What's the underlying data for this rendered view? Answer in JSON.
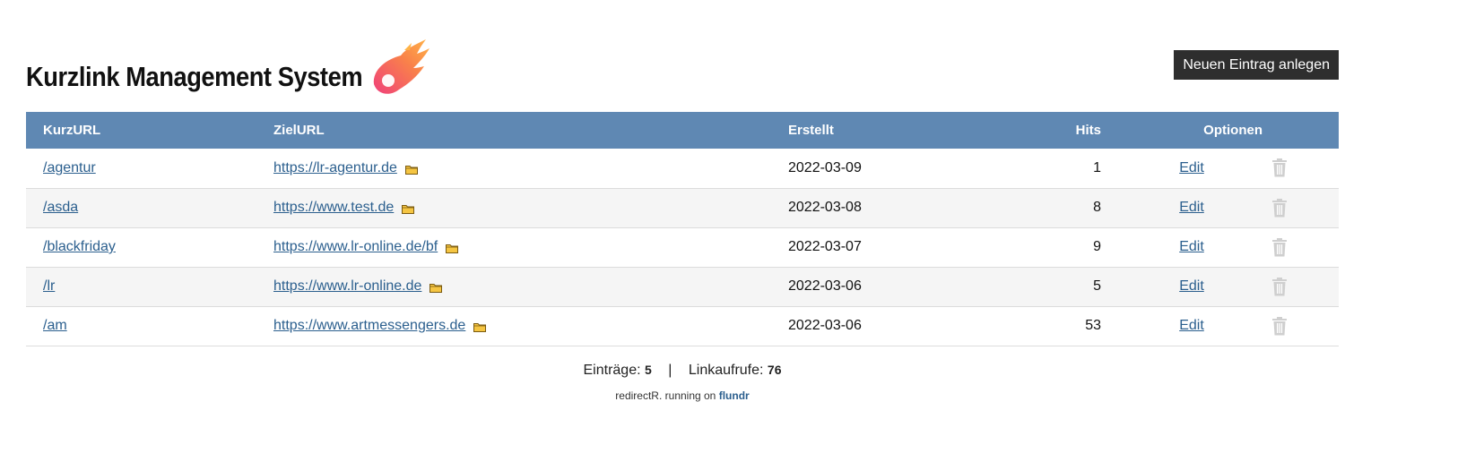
{
  "header": {
    "title": "Kurzlink Management System",
    "new_button": "Neuen Eintrag anlegen"
  },
  "table": {
    "columns": [
      "KurzURL",
      "ZielURL",
      "Erstellt",
      "Hits",
      "Optionen"
    ],
    "rows": [
      {
        "short": "/agentur",
        "target": "https://lr-agentur.de",
        "created": "2022-03-09",
        "hits": "1",
        "edit": "Edit"
      },
      {
        "short": "/asda",
        "target": "https://www.test.de",
        "created": "2022-03-08",
        "hits": "8",
        "edit": "Edit"
      },
      {
        "short": "/blackfriday",
        "target": "https://www.lr-online.de/bf",
        "created": "2022-03-07",
        "hits": "9",
        "edit": "Edit"
      },
      {
        "short": "/lr",
        "target": "https://www.lr-online.de",
        "created": "2022-03-06",
        "hits": "5",
        "edit": "Edit"
      },
      {
        "short": "/am",
        "target": "https://www.artmessengers.de",
        "created": "2022-03-06",
        "hits": "53",
        "edit": "Edit"
      }
    ]
  },
  "stats": {
    "entries_label": "Einträge:",
    "entries_value": "5",
    "separator": "|",
    "calls_label": "Linkaufrufe:",
    "calls_value": "76"
  },
  "footer": {
    "text": "redirectR. running on",
    "brand": "flundr"
  },
  "colors": {
    "header_bg": "#5f88b3",
    "link": "#2b5f8e",
    "button_bg": "#2e2e2e"
  },
  "icons": [
    "comet-logo-icon",
    "folder-icon",
    "trash-icon"
  ]
}
